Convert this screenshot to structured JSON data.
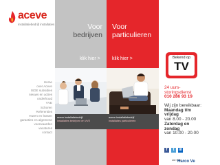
{
  "brand": {
    "name": "aceve",
    "tagline": "installatiebedrijf installaties"
  },
  "nav": [
    "Home",
    "over Aceve",
    "ISDE subsidies",
    "nieuws en acties",
    "onderhoud",
    "VVE",
    "Schoren",
    "Referenties",
    "Huren en leasen",
    "garanties en algemene",
    "voorwaarden",
    "vacatures",
    "contact"
  ],
  "panels": {
    "business": {
      "line1": "Voor",
      "line2": "bedrijven",
      "link": "klik hier >"
    },
    "private": {
      "line1": "Voor",
      "line2": "particulieren",
      "link": "klik hier >"
    }
  },
  "captions": {
    "left_1": "aceve installatiebedrijf",
    "left_2": "installaties bedrijven en VVE",
    "right_1": "aceve installatiebedrijf",
    "right_2": "installaties particulieren"
  },
  "badge": {
    "top": "Bekend op",
    "big": "TV"
  },
  "service": {
    "line1": "24 uurs-",
    "line2": "storingsdienst",
    "phone": "010 286 93 19"
  },
  "hours": {
    "intro1": "Wij zijn bereikbaar:",
    "weekdays": "Maandag t/m",
    "weekdays2": "vrijdag",
    "weekday_time": "van 8.00 - 20.00",
    "weekend": "Zaterdag en",
    "weekend2": "zondag",
    "weekend_time": "van 10.00 - 20.00"
  },
  "partner": {
    "label": "Lid van",
    "name": "Harco Ve"
  },
  "colors": {
    "accent_red": "#e5262b",
    "panel_grey": "#c3c3c3",
    "text_grey": "#8a8a8a"
  }
}
